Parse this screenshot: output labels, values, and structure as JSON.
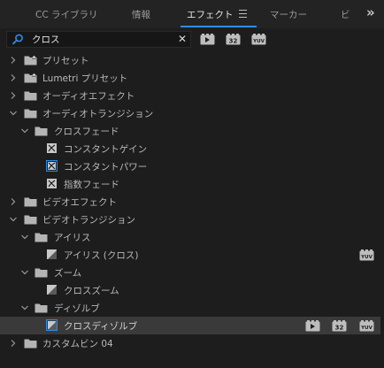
{
  "tabs": [
    {
      "label": "CC ライブラリ",
      "active": false
    },
    {
      "label": "情報",
      "active": false
    },
    {
      "label": "エフェクト",
      "active": true
    },
    {
      "label": "マーカー",
      "active": false
    },
    {
      "label": "ビ",
      "active": false
    }
  ],
  "search": {
    "value": "クロス",
    "placeholder": ""
  },
  "filter_badges": {
    "accelerated": "▶",
    "bit32": "32",
    "yuv": "YUV"
  },
  "tree": [
    {
      "label": "プリセット",
      "kind": "folder-star",
      "depth": 0,
      "expanded": false
    },
    {
      "label": "Lumetri プリセット",
      "kind": "folder-star",
      "depth": 0,
      "expanded": false
    },
    {
      "label": "オーディオエフェクト",
      "kind": "folder",
      "depth": 0,
      "expanded": false
    },
    {
      "label": "オーディオトランジション",
      "kind": "folder",
      "depth": 0,
      "expanded": true
    },
    {
      "label": "クロスフェード",
      "kind": "folder",
      "depth": 1,
      "expanded": true
    },
    {
      "label": "コンスタントゲイン",
      "kind": "audio",
      "depth": 2
    },
    {
      "label": "コンスタントパワー",
      "kind": "audio-default",
      "depth": 2
    },
    {
      "label": "指数フェード",
      "kind": "audio",
      "depth": 2
    },
    {
      "label": "ビデオエフェクト",
      "kind": "folder",
      "depth": 0,
      "expanded": false
    },
    {
      "label": "ビデオトランジション",
      "kind": "folder",
      "depth": 0,
      "expanded": true
    },
    {
      "label": "アイリス",
      "kind": "folder",
      "depth": 1,
      "expanded": true
    },
    {
      "label": "アイリス (クロス)",
      "kind": "video",
      "depth": 2,
      "badges": [
        "yuv"
      ]
    },
    {
      "label": "ズーム",
      "kind": "folder",
      "depth": 1,
      "expanded": true
    },
    {
      "label": "クロスズーム",
      "kind": "video",
      "depth": 2
    },
    {
      "label": "ディゾルブ",
      "kind": "folder",
      "depth": 1,
      "expanded": true
    },
    {
      "label": "クロスディゾルブ",
      "kind": "video-default",
      "depth": 2,
      "selected": true,
      "badges": [
        "accelerated",
        "bit32",
        "yuv"
      ]
    },
    {
      "label": "カスタムビン 04",
      "kind": "folder",
      "depth": 0,
      "expanded": false
    }
  ],
  "colors": {
    "accent": "#2d8ceb",
    "background": "#1d1d1d",
    "selected_row": "#3a3a3a"
  }
}
